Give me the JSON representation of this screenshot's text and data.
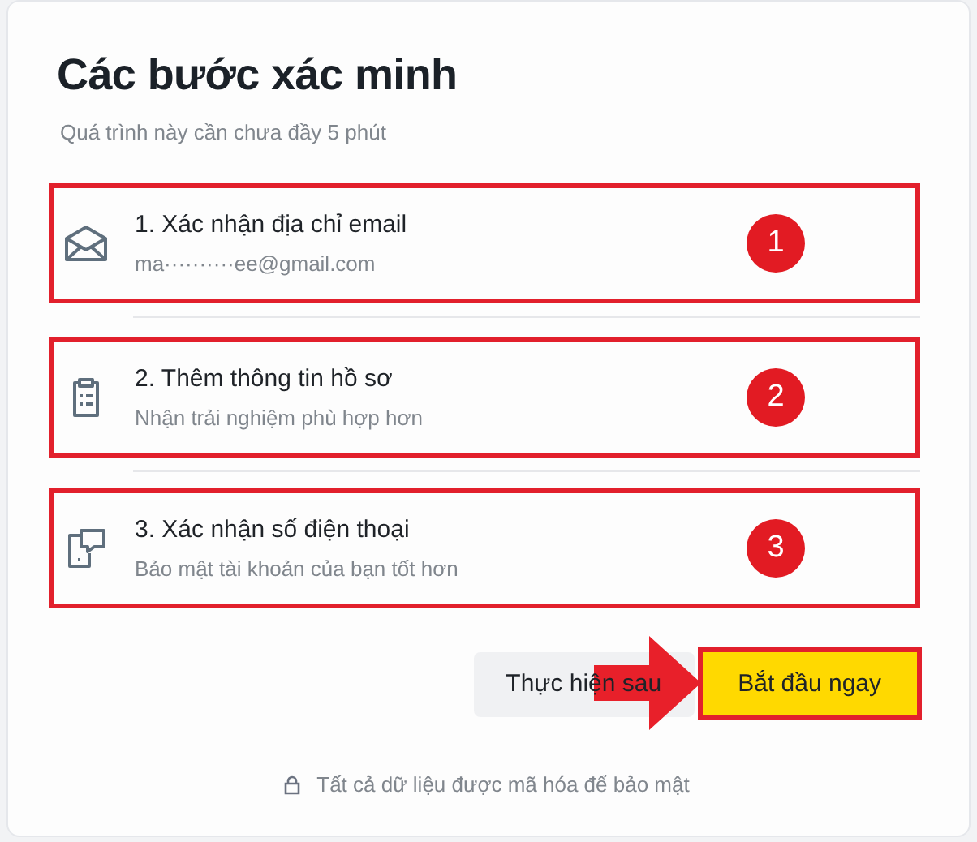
{
  "title": "Các bước xác minh",
  "subtitle": "Quá trình này cần chưa đầy 5 phút",
  "steps": [
    {
      "title": "1. Xác nhận địa chỉ email",
      "detail": "ma··········ee@gmail.com",
      "marker": "1"
    },
    {
      "title": "2. Thêm thông tin hồ sơ",
      "detail": "Nhận trải nghiệm phù hợp hơn",
      "marker": "2"
    },
    {
      "title": "3. Xác nhận số điện thoại",
      "detail": "Bảo mật tài khoản của bạn tốt hơn",
      "marker": "3"
    }
  ],
  "buttons": [
    {
      "kind": "secondary",
      "label": "Thực hiện sau"
    },
    {
      "kind": "primary",
      "label": "Bắt đầu ngay"
    }
  ],
  "footer": "Tất cả dữ liệu được mã hóa để bảo mật"
}
